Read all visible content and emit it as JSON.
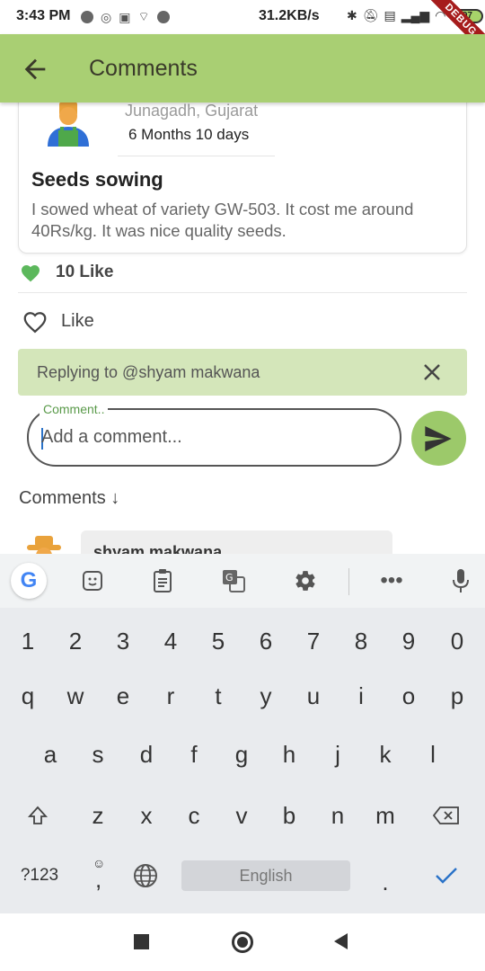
{
  "status_bar": {
    "time": "3:43 PM",
    "net_speed": "31.2KB/s",
    "battery": "97",
    "debug_banner": "DEBUG"
  },
  "app_bar": {
    "title": "Comments",
    "back_icon": "arrow-back-icon"
  },
  "post": {
    "location": "Junagadh, Gujarat",
    "time_ago": "6 Months  10 days",
    "title": "Seeds sowing",
    "body": "I sowed wheat of variety GW-503. It cost me around 40Rs/kg. It was nice quality seeds."
  },
  "likes": {
    "count_label": "10 Like",
    "button_label": "Like"
  },
  "reply": {
    "text": "Replying to @shyam makwana"
  },
  "comment_input": {
    "label": "Comment..",
    "placeholder": "Add a comment..."
  },
  "comments": {
    "heading": "Comments ↓",
    "items": [
      {
        "name": "shyam makwana"
      }
    ]
  },
  "keyboard": {
    "row_numbers": [
      "1",
      "2",
      "3",
      "4",
      "5",
      "6",
      "7",
      "8",
      "9",
      "0"
    ],
    "row_top": [
      "q",
      "w",
      "e",
      "r",
      "t",
      "y",
      "u",
      "i",
      "o",
      "p"
    ],
    "row_middle": [
      "a",
      "s",
      "d",
      "f",
      "g",
      "h",
      "j",
      "k",
      "l"
    ],
    "row_bottom": [
      "z",
      "x",
      "c",
      "v",
      "b",
      "n",
      "m"
    ],
    "symbols_key": "?123",
    "comma_key": ",",
    "space_label": "English",
    "period_key": "."
  },
  "colors": {
    "app_bar": "#a9cf73",
    "accent_green": "#9cc96a",
    "reply_banner": "#d4e6ba",
    "like_heart": "#5cb85c"
  }
}
